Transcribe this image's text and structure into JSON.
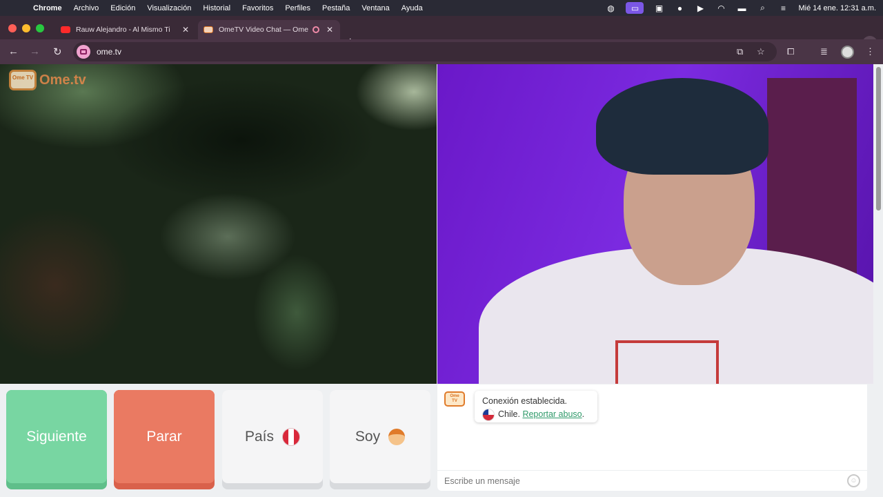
{
  "menubar": {
    "app": "Chrome",
    "items": [
      "Archivo",
      "Edición",
      "Visualización",
      "Historial",
      "Favoritos",
      "Perfiles",
      "Pestaña",
      "Ventana",
      "Ayuda"
    ],
    "clock": "Mié 14 ene.  12:31 a.m."
  },
  "tabs": [
    {
      "title": "Rauw Alejandro - Al Mismo Ti",
      "favicon": "youtube-icon",
      "active": false
    },
    {
      "title": "OmeTV Video Chat — Ome",
      "favicon": "ometv-icon",
      "active": true
    }
  ],
  "toolbar": {
    "url": "ome.tv"
  },
  "logo": {
    "tv": "Ome TV",
    "text": "Ome.tv"
  },
  "controls": {
    "next": "Siguiente",
    "stop": "Parar",
    "country": "País",
    "gender": "Soy"
  },
  "chat": {
    "status": "Conexión establecida.",
    "country": "Chile.",
    "report": "Reportar abuso",
    "report_suffix": ".",
    "placeholder": "Escribe un mensaje"
  },
  "colors": {
    "next": "#78d6a2",
    "stop": "#ea7a62",
    "accent": "#7b2ae0"
  }
}
